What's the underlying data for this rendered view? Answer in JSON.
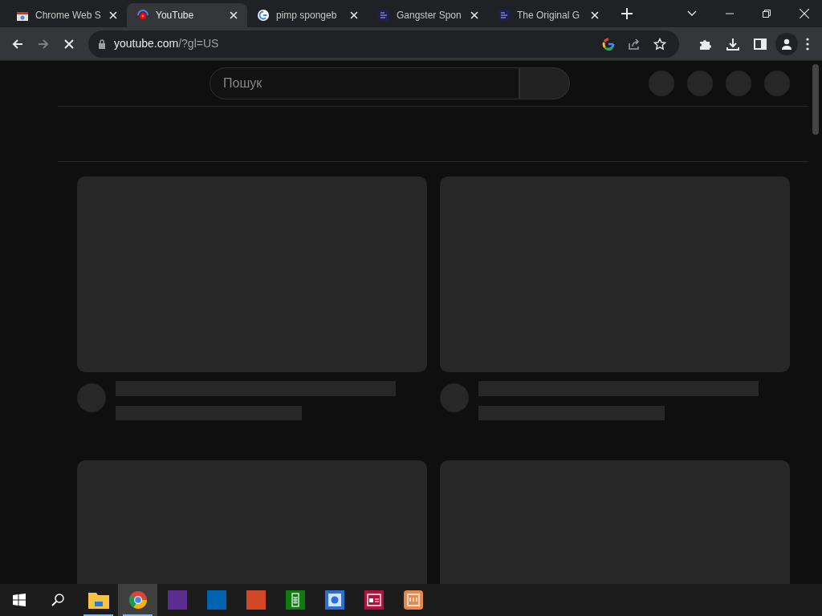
{
  "tabs": [
    {
      "title": "Chrome Web S",
      "kind": "store",
      "selected": false
    },
    {
      "title": "YouTube",
      "kind": "youtube",
      "selected": true
    },
    {
      "title": "pimp spongeb",
      "kind": "google",
      "selected": false
    },
    {
      "title": "Gangster Spon",
      "kind": "doc",
      "selected": false
    },
    {
      "title": "The Original G",
      "kind": "doc",
      "selected": false
    }
  ],
  "address": {
    "host": "youtube.com",
    "path": "/?gl=US"
  },
  "search": {
    "placeholder": "Пошук"
  },
  "taskbar": [
    {
      "kind": "explorer",
      "running": true,
      "selected": false
    },
    {
      "kind": "chrome",
      "running": true,
      "selected": true
    },
    {
      "kind": "purple",
      "running": false,
      "selected": false
    },
    {
      "kind": "blue",
      "running": false,
      "selected": false
    },
    {
      "kind": "orange",
      "running": false,
      "selected": false
    },
    {
      "kind": "calculator",
      "running": false,
      "selected": false
    },
    {
      "kind": "camera",
      "running": false,
      "selected": false
    },
    {
      "kind": "news",
      "running": false,
      "selected": false
    },
    {
      "kind": "notes",
      "running": false,
      "selected": false
    }
  ]
}
